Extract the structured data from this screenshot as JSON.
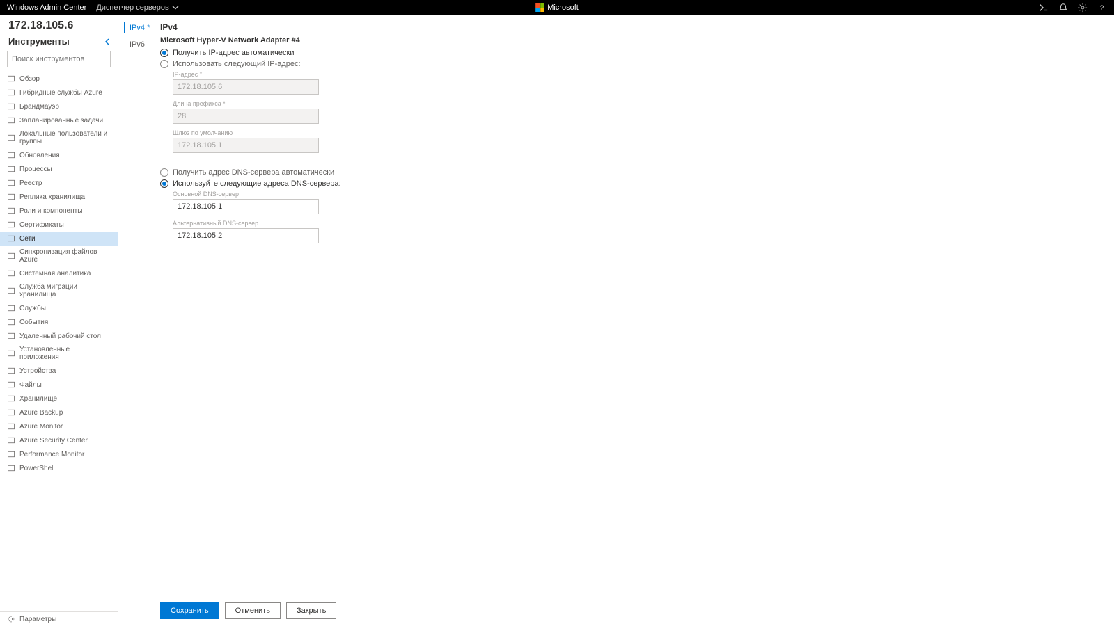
{
  "topbar": {
    "app_name": "Windows Admin Center",
    "context_menu": "Диспетчер серверов",
    "brand": "Microsoft"
  },
  "server": {
    "name": "172.18.105.6"
  },
  "tools": {
    "header": "Инструменты",
    "search_placeholder": "Поиск инструментов",
    "params": "Параметры",
    "items": [
      "Обзор",
      "Гибридные службы Azure",
      "Брандмауэр",
      "Запланированные задачи",
      "Локальные пользователи и группы",
      "Обновления",
      "Процессы",
      "Реестр",
      "Реплика хранилища",
      "Роли и компоненты",
      "Сертификаты",
      "Сети",
      "Синхронизация файлов Azure",
      "Системная аналитика",
      "Служба миграции хранилища",
      "Службы",
      "События",
      "Удаленный рабочий стол",
      "Установленные приложения",
      "Устройства",
      "Файлы",
      "Хранилище",
      "Azure Backup",
      "Azure Monitor",
      "Azure Security Center",
      "Performance Monitor",
      "PowerShell"
    ],
    "active_index": 11
  },
  "subtabs": {
    "items": [
      "IPv4 *",
      "IPv6"
    ],
    "active_index": 0
  },
  "form": {
    "section_title": "IPv4",
    "adapter_name": "Microsoft Hyper-V Network Adapter #4",
    "ip_mode": {
      "auto_label": "Получить IP-адрес автоматически",
      "manual_label": "Использовать следующий IP-адрес:",
      "selected": "auto"
    },
    "fields": {
      "ip_label": "IP-адрес *",
      "ip_value": "172.18.105.6",
      "prefix_label": "Длина префикса *",
      "prefix_value": "28",
      "gateway_label": "Шлюз по умолчанию",
      "gateway_value": "172.18.105.1"
    },
    "dns_mode": {
      "auto_label": "Получить адрес DNS-сервера автоматически",
      "manual_label": "Используйте следующие адреса DNS-сервера:",
      "selected": "manual"
    },
    "dns": {
      "primary_label": "Основной DNS-сервер",
      "primary_value": "172.18.105.1",
      "alt_label": "Альтернативный DNS-сервер",
      "alt_value": "172.18.105.2"
    },
    "buttons": {
      "save": "Сохранить",
      "cancel": "Отменить",
      "close": "Закрыть"
    }
  }
}
